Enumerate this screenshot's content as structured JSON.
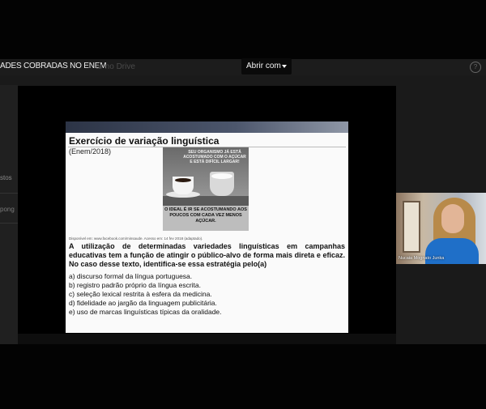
{
  "header": {
    "doc_title": "ADES COBRADAS NO ENEM",
    "ghost_title": "ar no Drive",
    "open_with_label": "Abrir com",
    "help_icon": "?"
  },
  "left_panel": {
    "label_1": "stos",
    "label_2": "pong"
  },
  "slide": {
    "title": "Exercício de variação linguística",
    "subtitle": "(Enem/2018)",
    "cartoon": {
      "top_caption": "SEU ORGANISMO JÁ ESTÁ ACOSTUMADO COM O AÇÚCAR E ESTÁ DIFÍCIL LARGAR!",
      "bottom_caption": "O IDEAL É IR SE ACOSTUMANDO AOS POUCOS COM CADA VEZ MENOS AÇÚCAR."
    },
    "credit": "Disponível em: www.facebook.com/minsaude. Acesso em: 14 fev 2018 (adaptado).",
    "question": "A utilização de determinadas variedades linguísticas em campanhas educativas tem a função de atingir o público-alvo de forma mais direta e eficaz. No caso desse texto, identifica-se essa estratégia pelo(a)",
    "options": [
      "a) discurso formal da língua portuguesa.",
      "b) registro padrão próprio da língua escrita.",
      "c) seleção lexical restrita à esfera da medicina.",
      "d) fidelidade ao jargão da linguagem publicitária.",
      "e) uso de marcas linguísticas típicas da oralidade."
    ]
  },
  "video_call": {
    "participant_name": "Nucaia Mognato Junka"
  },
  "icons": {
    "open_with_caret": "chevron-down-icon",
    "help": "help-circle-icon"
  }
}
